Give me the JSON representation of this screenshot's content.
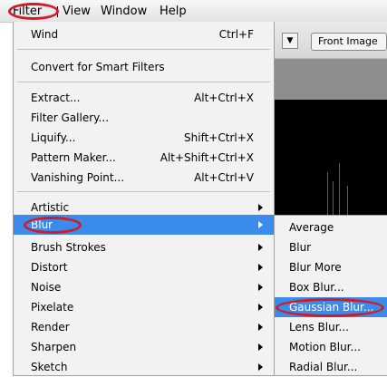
{
  "menubar": {
    "items": [
      "Filter",
      "View",
      "Window",
      "Help"
    ],
    "active": "Filter"
  },
  "options_bar": {
    "dropdown_icon": "chevron-down-icon",
    "front_image_button": "Front Image"
  },
  "filter_menu": {
    "groups": [
      [
        {
          "label": "Wind",
          "shortcut": "Ctrl+F"
        }
      ],
      [
        {
          "label": "Convert for Smart Filters"
        }
      ],
      [
        {
          "label": "Extract...",
          "shortcut": "Alt+Ctrl+X"
        },
        {
          "label": "Filter Gallery..."
        },
        {
          "label": "Liquify...",
          "shortcut": "Shift+Ctrl+X"
        },
        {
          "label": "Pattern Maker...",
          "shortcut": "Alt+Shift+Ctrl+X"
        },
        {
          "label": "Vanishing Point...",
          "shortcut": "Alt+Ctrl+V"
        }
      ],
      [
        {
          "label": "Artistic",
          "submenu": true
        },
        {
          "label": "Blur",
          "submenu": true,
          "highlighted": true
        },
        {
          "label": "Brush Strokes",
          "submenu": true
        },
        {
          "label": "Distort",
          "submenu": true
        },
        {
          "label": "Noise",
          "submenu": true
        },
        {
          "label": "Pixelate",
          "submenu": true
        },
        {
          "label": "Render",
          "submenu": true
        },
        {
          "label": "Sharpen",
          "submenu": true
        },
        {
          "label": "Sketch",
          "submenu": true
        }
      ]
    ]
  },
  "blur_submenu": {
    "items": [
      "Average",
      "Blur",
      "Blur More",
      "Box Blur...",
      "Gaussian Blur...",
      "Lens Blur...",
      "Motion Blur...",
      "Radial Blur..."
    ],
    "highlighted": "Gaussian Blur..."
  },
  "colors": {
    "highlight": "#3b8bea",
    "annotation_ring": "#d11a2a",
    "menu_bg": "#f2f2f2"
  }
}
